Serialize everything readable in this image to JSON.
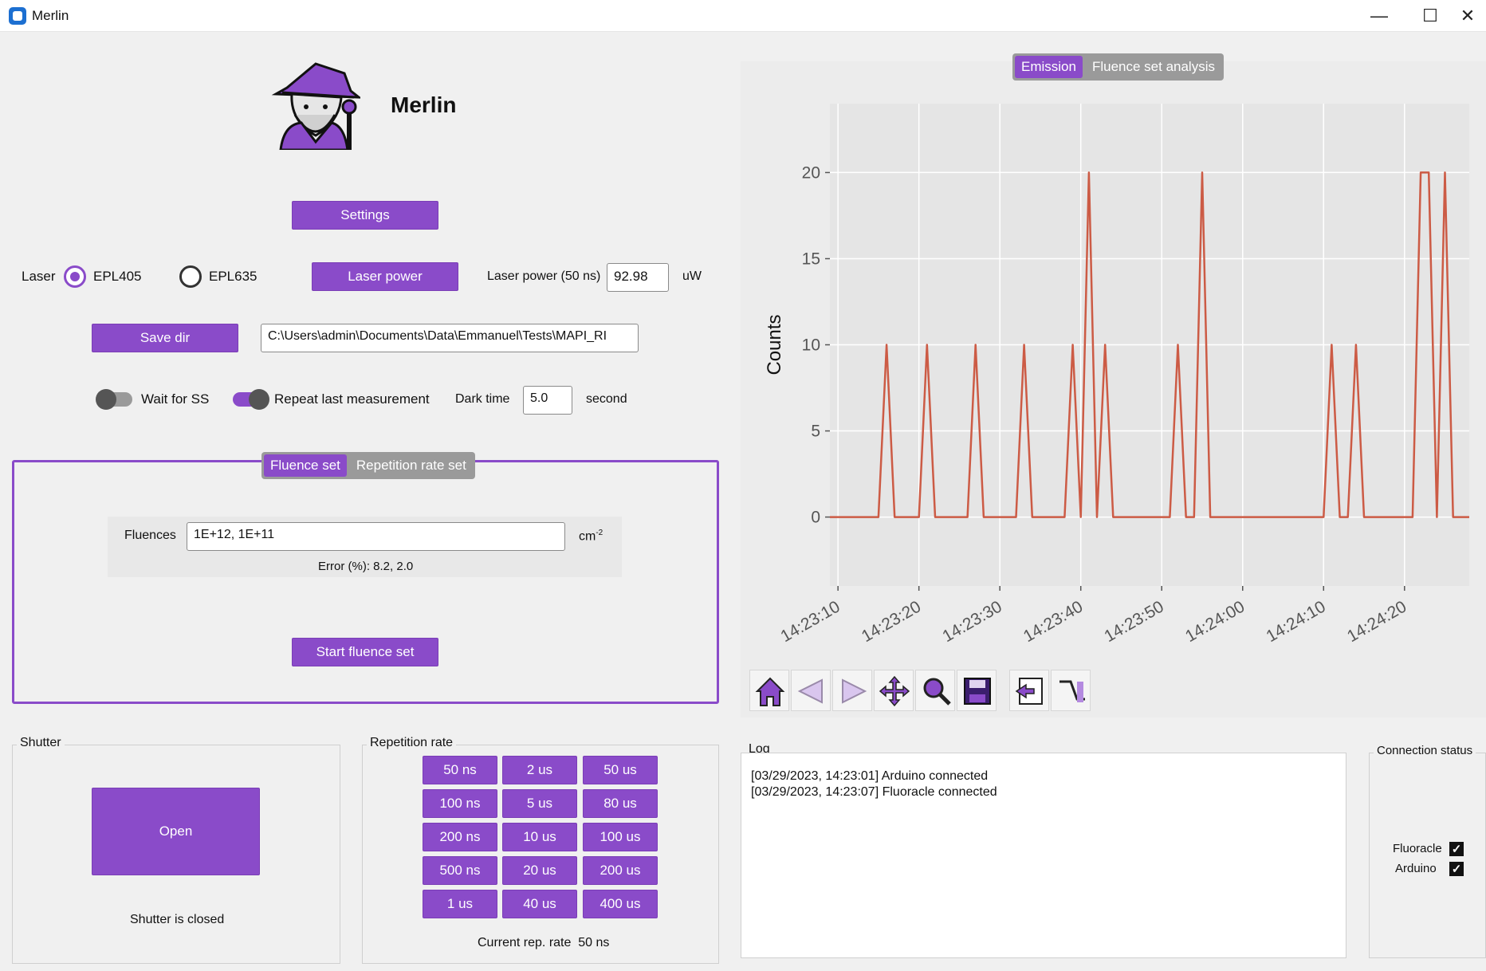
{
  "window": {
    "title": "Merlin",
    "minimize": "—",
    "maximize": "☐",
    "close": "✕"
  },
  "app": {
    "title": "Merlin"
  },
  "settings_label": "Settings",
  "laser": {
    "label": "Laser",
    "options": [
      "EPL405",
      "EPL635"
    ],
    "selected": "EPL405",
    "power_button": "Laser power",
    "power_label": "Laser power (50 ns)",
    "power_value": "92.98",
    "power_unit": "uW"
  },
  "save": {
    "button": "Save dir",
    "path": "C:\\Users\\admin\\Documents\\Data\\Emmanuel\\Tests\\MAPI_RI"
  },
  "options": {
    "wait_ss": "Wait for SS",
    "wait_ss_on": false,
    "repeat": "Repeat last measurement",
    "repeat_on": true,
    "dark_time_label": "Dark time",
    "dark_time_value": "5.0",
    "dark_time_unit": "second"
  },
  "fluence": {
    "tabs": [
      "Fluence set",
      "Repetition rate set"
    ],
    "active_tab": "Fluence set",
    "fluences_label": "Fluences",
    "fluences_value": "1E+12, 1E+11",
    "unit": "cm",
    "unit_exp": "-2",
    "error": "Error (%): 8.2, 2.0",
    "start_button": "Start fluence set"
  },
  "shutter": {
    "title": "Shutter",
    "button": "Open",
    "status": "Shutter is closed"
  },
  "reprate": {
    "title": "Repetition rate",
    "buttons": [
      [
        "50 ns",
        "2 us",
        "50 us"
      ],
      [
        "100 ns",
        "5 us",
        "80 us"
      ],
      [
        "200 ns",
        "10 us",
        "100 us"
      ],
      [
        "500 ns",
        "20 us",
        "200 us"
      ],
      [
        "1 us",
        "40 us",
        "400 us"
      ]
    ],
    "current_label": "Current rep. rate",
    "current_value": "50 ns"
  },
  "plot_tabs": [
    "Emission",
    "Fluence set analysis"
  ],
  "plot_active_tab": "Emission",
  "chart_data": {
    "type": "line",
    "ylabel": "Counts",
    "ylim": [
      -4,
      24
    ],
    "yticks": [
      0,
      5,
      10,
      15,
      20
    ],
    "xlim": [
      "14:23:09",
      "14:24:28"
    ],
    "xticks": [
      "14:23:10",
      "14:23:20",
      "14:23:30",
      "14:23:40",
      "14:23:50",
      "14:24:00",
      "14:24:10",
      "14:24:20"
    ],
    "grid": true,
    "line_color": "#cc5b45",
    "series": [
      {
        "x": [
          "14:23:09",
          "14:23:15",
          "14:23:16",
          "14:23:17",
          "14:23:20",
          "14:23:21",
          "14:23:22",
          "14:23:26",
          "14:23:27",
          "14:23:28",
          "14:23:32",
          "14:23:33",
          "14:23:34",
          "14:23:38",
          "14:23:39",
          "14:23:40",
          "14:23:41",
          "14:23:42",
          "14:23:43",
          "14:23:44",
          "14:23:45",
          "14:23:51",
          "14:23:52",
          "14:23:53",
          "14:23:54",
          "14:23:55",
          "14:23:56",
          "14:24:10",
          "14:24:11",
          "14:24:12",
          "14:24:13",
          "14:24:14",
          "14:24:15",
          "14:24:21",
          "14:24:22",
          "14:24:23",
          "14:24:24",
          "14:24:25",
          "14:24:26",
          "14:24:28"
        ],
        "y": [
          0,
          0,
          10,
          0,
          0,
          10,
          0,
          0,
          10,
          0,
          0,
          10,
          0,
          0,
          10,
          0,
          20,
          0,
          10,
          0,
          0,
          0,
          10,
          0,
          0,
          20,
          0,
          0,
          10,
          0,
          0,
          10,
          0,
          0,
          20,
          20,
          0,
          20,
          0,
          0
        ]
      }
    ]
  },
  "toolbar_icons": [
    "home-icon",
    "back-icon",
    "forward-icon",
    "pan-icon",
    "zoom-icon",
    "save-icon",
    "subplots-icon",
    "edit-axis-icon"
  ],
  "log": {
    "title": "Log",
    "lines": [
      "[03/29/2023, 14:23:01] Arduino connected",
      "[03/29/2023, 14:23:07] Fluoracle connected"
    ]
  },
  "connection": {
    "title": "Connection status",
    "items": [
      "Fluoracle",
      "Arduino"
    ],
    "checkmark": "✓"
  }
}
